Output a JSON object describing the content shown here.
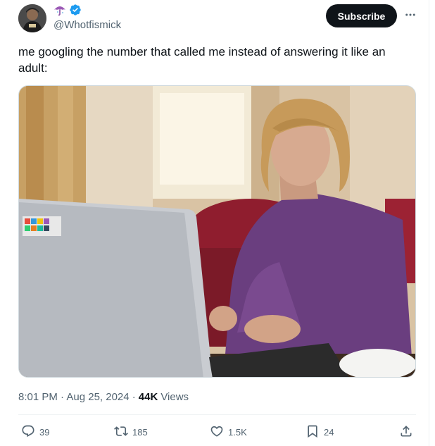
{
  "author": {
    "handle": "@Whotfismick",
    "avatar_icon": "avatar",
    "emoji_icon": "umbrella-icon",
    "verified_icon": "verified-badge-icon",
    "verified_color": "#1d9bf0"
  },
  "header": {
    "subscribe_label": "Subscribe",
    "more_icon": "more-icon"
  },
  "tweet": {
    "text": "me googling the number that called me instead of answering it like an adult:",
    "timestamp": "8:01 PM · Aug 25, 2024 · ",
    "views_count": "44K",
    "views_label": "Views"
  },
  "actions": {
    "replies": "39",
    "retweets": "185",
    "likes": "1.5K",
    "bookmarks": "24"
  },
  "colors": {
    "text": "#0f1419",
    "secondary": "#536471",
    "accent": "#1d9bf0",
    "border": "#eff3f4"
  }
}
